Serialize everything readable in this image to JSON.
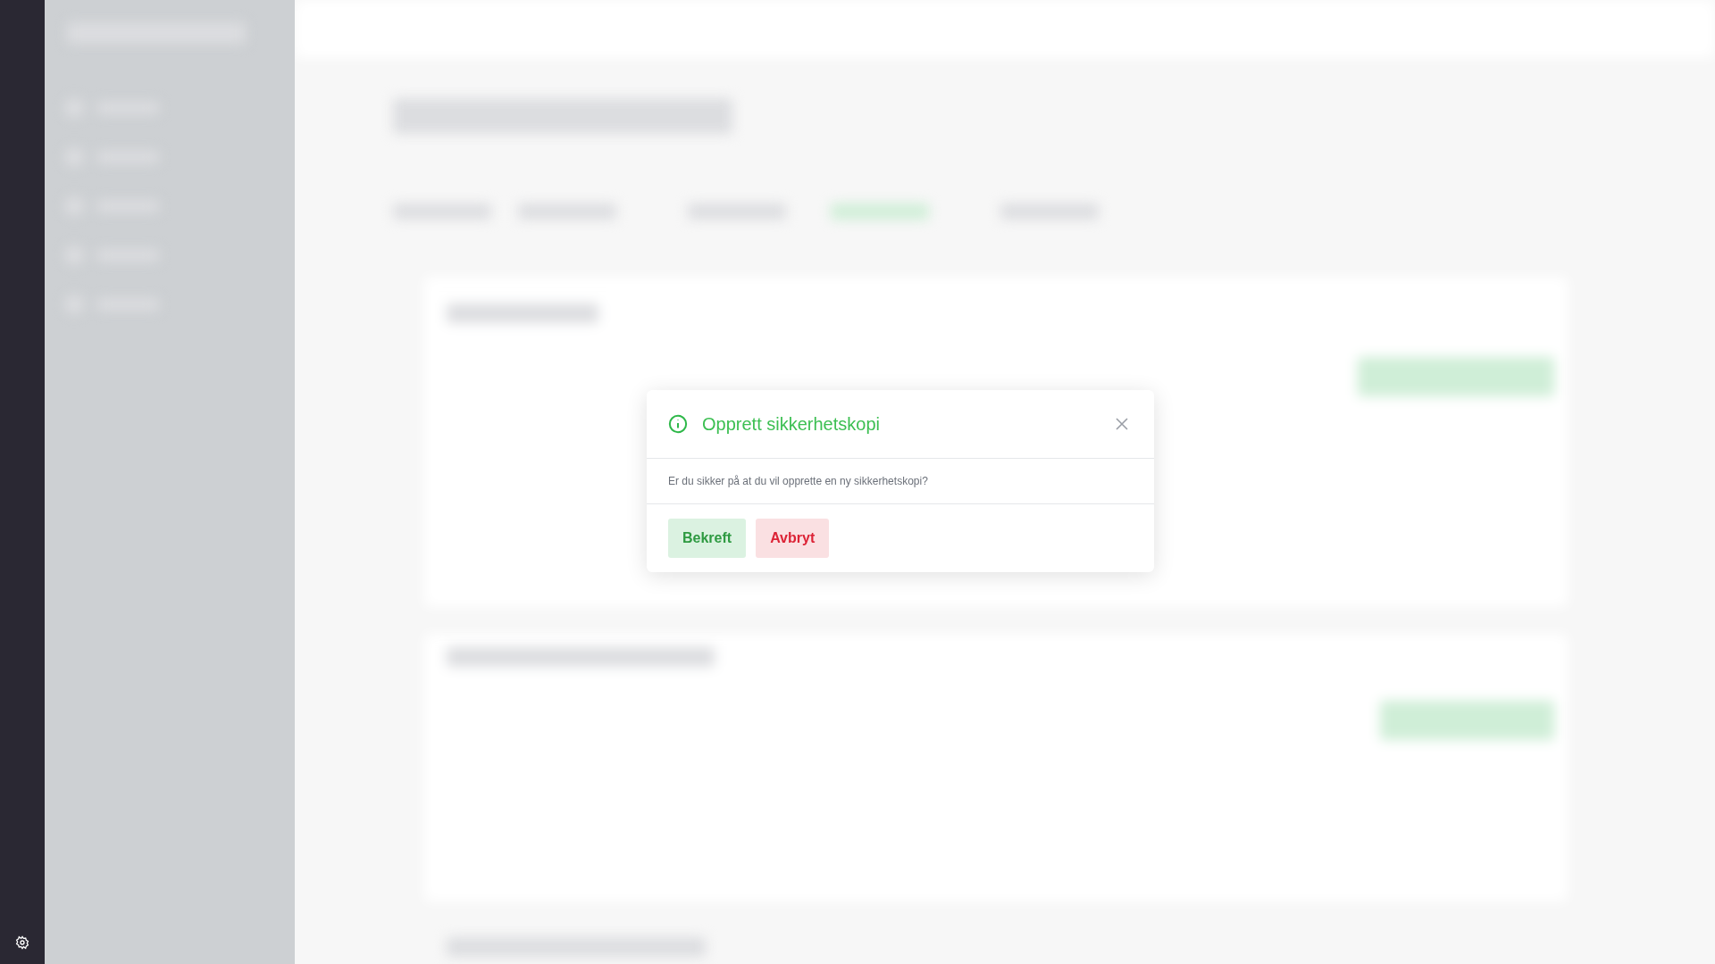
{
  "modal": {
    "title": "Opprett sikkerhetskopi",
    "message": "Er du sikker på at du vil opprette en ny sikkerhetskopi?",
    "buttons": [
      {
        "label": "Bekreft",
        "kind": "confirm"
      },
      {
        "label": "Avbryt",
        "kind": "cancel"
      }
    ]
  }
}
